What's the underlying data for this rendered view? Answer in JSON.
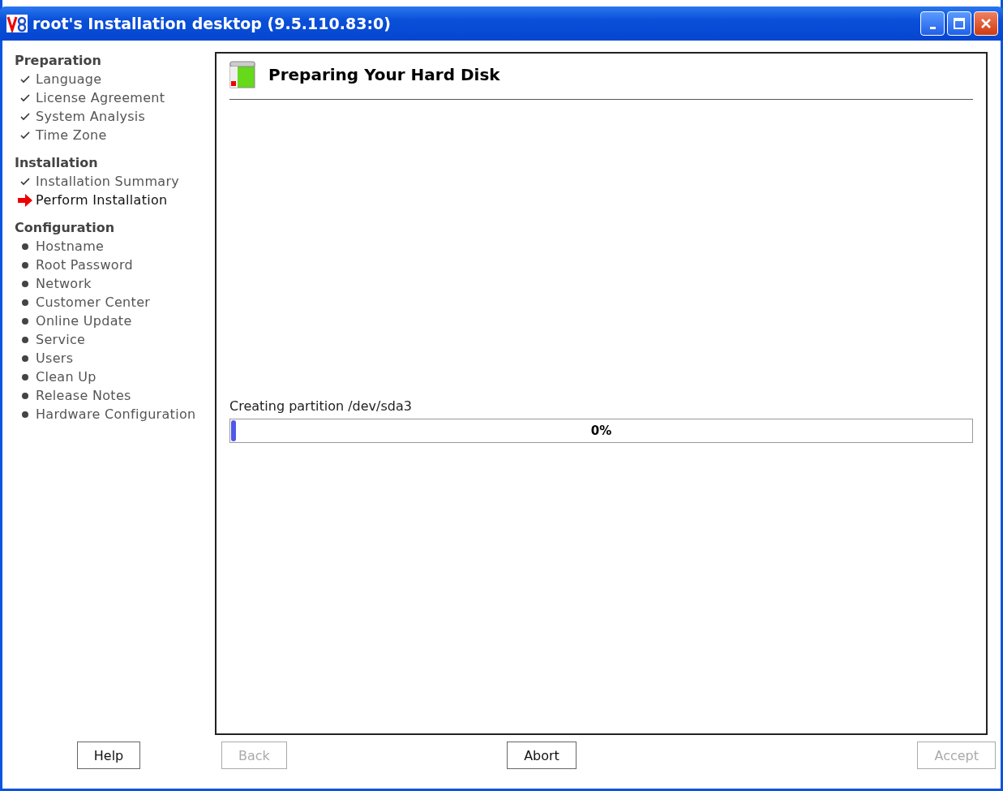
{
  "window": {
    "title": "root's Installation desktop (9.5.110.83:0)"
  },
  "sidebar": {
    "sections": [
      {
        "title": "Preparation",
        "steps": [
          {
            "label": "Language",
            "kind": "done"
          },
          {
            "label": "License Agreement",
            "kind": "done"
          },
          {
            "label": "System Analysis",
            "kind": "done"
          },
          {
            "label": "Time Zone",
            "kind": "done"
          }
        ]
      },
      {
        "title": "Installation",
        "steps": [
          {
            "label": "Installation Summary",
            "kind": "done"
          },
          {
            "label": "Perform Installation",
            "kind": "current"
          }
        ]
      },
      {
        "title": "Configuration",
        "steps": [
          {
            "label": "Hostname",
            "kind": "pending"
          },
          {
            "label": "Root Password",
            "kind": "pending"
          },
          {
            "label": "Network",
            "kind": "pending"
          },
          {
            "label": "Customer Center",
            "kind": "pending"
          },
          {
            "label": "Online Update",
            "kind": "pending"
          },
          {
            "label": "Service",
            "kind": "pending"
          },
          {
            "label": "Users",
            "kind": "pending"
          },
          {
            "label": "Clean Up",
            "kind": "pending"
          },
          {
            "label": "Release Notes",
            "kind": "pending"
          },
          {
            "label": "Hardware Configuration",
            "kind": "pending"
          }
        ]
      }
    ]
  },
  "content": {
    "heading": "Preparing Your Hard Disk",
    "progress_label": "Creating partition /dev/sda3",
    "progress": {
      "level": 0.005,
      "reading": "0%"
    }
  },
  "buttons": [
    {
      "label": "Help",
      "disabled": false
    },
    {
      "label": "Back",
      "disabled": true
    },
    {
      "label": "Abort",
      "disabled": false
    },
    {
      "label": "Accept",
      "disabled": true
    }
  ]
}
